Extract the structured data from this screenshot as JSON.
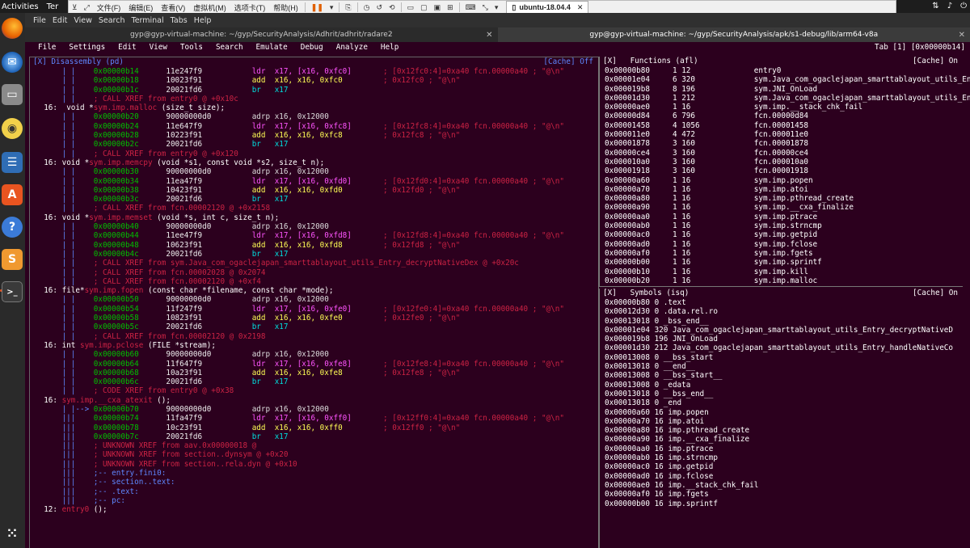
{
  "topbar": {
    "activities": "Activities",
    "app_label": "Ter"
  },
  "vmware": {
    "menus": [
      "文件(F)",
      "编辑(E)",
      "查看(V)",
      "虚拟机(M)",
      "选项卡(T)",
      "帮助(H)"
    ],
    "tab_label": "ubuntu-18.04.4"
  },
  "terminal": {
    "menubar": [
      "File",
      "Edit",
      "View",
      "Search",
      "Terminal",
      "Tabs",
      "Help"
    ],
    "tabs": [
      {
        "title": "gyp@gyp-virtual-machine: ~/gyp/SecurityAnalysis/Adhrit/adhrit/radare2",
        "active": false
      },
      {
        "title": "gyp@gyp-virtual-machine: ~/gyp/SecurityAnalysis/apk/s1-debug/lib/arm64-v8a",
        "active": true
      }
    ]
  },
  "r2": {
    "menu": [
      "File",
      "Settings",
      "Edit",
      "View",
      "Tools",
      "Search",
      "Emulate",
      "Debug",
      "Analyze",
      "Help"
    ],
    "tab_indicator": "Tab [1] [0x00000b14]",
    "disasm_title": "[X] Disassembly (pd)",
    "disasm_cache": "[Cache] Off",
    "functions_title": "[X]   Functions (afl)",
    "functions_cache": "[Cache] On",
    "symbols_title": "[X]   Symbols (isq)",
    "symbols_cache": "[Cache] On"
  },
  "disasm": [
    {
      "g": "      | |    ",
      "a": "0x00000b14",
      "b": "11e247f9",
      "m": "ldr",
      "o": "x17, [x16, 0xfc0]",
      "c": "; [0x12fc0:4]=0xa40 fcn.00000a40 ; \"@\\n\"",
      "k": "ldr"
    },
    {
      "g": "      | |    ",
      "a": "0x00000b18",
      "b": "10023f91",
      "m": "add",
      "o": "x16, x16, 0xfc0",
      "c": "; 0x12fc0 ; \"@\\n\"",
      "k": "add"
    },
    {
      "g": "      | |    ",
      "a": "0x00000b1c",
      "b": "20021fd6",
      "m": "br",
      "o": "x17",
      "c": "",
      "k": "br"
    },
    {
      "t": "x",
      "g": "      | |    ",
      "text": "; CALL XREF from entry0 @ +0x10c"
    },
    {
      "t": "s",
      "g": "  ",
      "text": "16:  void *",
      "sym": "sym.imp.malloc",
      "rest": " (size_t size);"
    },
    {
      "g": "      | |    ",
      "a": "0x00000b20",
      "b": "90000000",
      "bc": "d0",
      "m": "adrp",
      "o": "x16, 0x12000",
      "c": "",
      "k": "adrp"
    },
    {
      "g": "      | |    ",
      "a": "0x00000b24",
      "b": "11e647f9",
      "m": "ldr",
      "o": "x17, [x16, 0xfc8]",
      "c": "; [0x12fc8:4]=0xa40 fcn.00000a40 ; \"@\\n\"",
      "k": "ldr"
    },
    {
      "g": "      | |    ",
      "a": "0x00000b28",
      "b": "10223f91",
      "m": "add",
      "o": "x16, x16, 0xfc8",
      "c": "; 0x12fc8 ; \"@\\n\"",
      "k": "add"
    },
    {
      "g": "      | |    ",
      "a": "0x00000b2c",
      "b": "20021fd6",
      "m": "br",
      "o": "x17",
      "c": "",
      "k": "br"
    },
    {
      "t": "x",
      "g": "      | |    ",
      "text": "; CALL XREF from entry0 @ +0x120"
    },
    {
      "t": "s",
      "g": "  ",
      "text": "16: void *",
      "sym": "sym.imp.memcpy",
      "rest": " (void *s1, const void *s2, size_t n);"
    },
    {
      "g": "      | |    ",
      "a": "0x00000b30",
      "b": "90000000",
      "bc": "d0",
      "m": "adrp",
      "o": "x16, 0x12000",
      "c": "",
      "k": "adrp"
    },
    {
      "g": "      | |    ",
      "a": "0x00000b34",
      "b": "11ea47f9",
      "m": "ldr",
      "o": "x17, [x16, 0xfd0]",
      "c": "; [0x12fd0:4]=0xa40 fcn.00000a40 ; \"@\\n\"",
      "k": "ldr"
    },
    {
      "g": "      | |    ",
      "a": "0x00000b38",
      "b": "10423f91",
      "m": "add",
      "o": "x16, x16, 0xfd0",
      "c": "; 0x12fd0 ; \"@\\n\"",
      "k": "add"
    },
    {
      "g": "      | |    ",
      "a": "0x00000b3c",
      "b": "20021fd6",
      "m": "br",
      "o": "x17",
      "c": "",
      "k": "br"
    },
    {
      "t": "x",
      "g": "      | |    ",
      "text": "; CALL XREF from fcn.00002120 @ +0x2158"
    },
    {
      "t": "s",
      "g": "  ",
      "text": "16: void *",
      "sym": "sym.imp.memset",
      "rest": " (void *s, int c, size_t n);"
    },
    {
      "g": "      | |    ",
      "a": "0x00000b40",
      "b": "90000000",
      "bc": "d0",
      "m": "adrp",
      "o": "x16, 0x12000",
      "c": "",
      "k": "adrp"
    },
    {
      "g": "      | |    ",
      "a": "0x00000b44",
      "b": "11ee47f9",
      "m": "ldr",
      "o": "x17, [x16, 0xfd8]",
      "c": "; [0x12fd8:4]=0xa40 fcn.00000a40 ; \"@\\n\"",
      "k": "ldr"
    },
    {
      "g": "      | |    ",
      "a": "0x00000b48",
      "b": "10623f91",
      "m": "add",
      "o": "x16, x16, 0xfd8",
      "c": "; 0x12fd8 ; \"@\\n\"",
      "k": "add"
    },
    {
      "g": "      | |    ",
      "a": "0x00000b4c",
      "b": "20021fd6",
      "m": "br",
      "o": "x17",
      "c": "",
      "k": "br"
    },
    {
      "t": "x",
      "g": "      | |    ",
      "text": "; CALL XREF from sym.Java_com_ogaclejapan_smarttablayout_utils_Entry_decryptNativeDex @ +0x20c"
    },
    {
      "t": "x",
      "g": "      | |    ",
      "text": "; CALL XREF from fcn.00002028 @ 0x2074"
    },
    {
      "t": "x",
      "g": "      | |    ",
      "text": "; CALL XREF from fcn.00002120 @ +0xf4"
    },
    {
      "t": "s",
      "g": "  ",
      "text": "16: file*",
      "sym": "sym.imp.fopen",
      "rest": " (const char *filename, const char *mode);"
    },
    {
      "g": "      | |    ",
      "a": "0x00000b50",
      "b": "90000000",
      "bc": "d0",
      "m": "adrp",
      "o": "x16, 0x12000",
      "c": "",
      "k": "adrp"
    },
    {
      "g": "      | |    ",
      "a": "0x00000b54",
      "b": "11f247f9",
      "m": "ldr",
      "o": "x17, [x16, 0xfe0]",
      "c": "; [0x12fe0:4]=0xa40 fcn.00000a40 ; \"@\\n\"",
      "k": "ldr"
    },
    {
      "g": "      | |    ",
      "a": "0x00000b58",
      "b": "10823f91",
      "m": "add",
      "o": "x16, x16, 0xfe0",
      "c": "; 0x12fe0 ; \"@\\n\"",
      "k": "add"
    },
    {
      "g": "      | |    ",
      "a": "0x00000b5c",
      "b": "20021fd6",
      "m": "br",
      "o": "x17",
      "c": "",
      "k": "br"
    },
    {
      "t": "x",
      "g": "      | |    ",
      "text": "; CALL XREF from fcn.00002120 @ 0x2198"
    },
    {
      "t": "s",
      "g": "  ",
      "text": "16: int ",
      "sym": "sym.imp.pclose",
      "rest": " (FILE *stream);"
    },
    {
      "g": "      | |    ",
      "a": "0x00000b60",
      "b": "90000000",
      "bc": "d0",
      "m": "adrp",
      "o": "x16, 0x12000",
      "c": "",
      "k": "adrp"
    },
    {
      "g": "      | |    ",
      "a": "0x00000b64",
      "b": "11f647f9",
      "m": "ldr",
      "o": "x17, [x16, 0xfe8]",
      "c": "; [0x12fe8:4]=0xa40 fcn.00000a40 ; \"@\\n\"",
      "k": "ldr"
    },
    {
      "g": "      | |    ",
      "a": "0x00000b68",
      "b": "10a23f91",
      "m": "add",
      "o": "x16, x16, 0xfe8",
      "c": "; 0x12fe8 ; \"@\\n\"",
      "k": "add"
    },
    {
      "g": "      | |    ",
      "a": "0x00000b6c",
      "b": "20021fd6",
      "m": "br",
      "o": "x17",
      "c": "",
      "k": "br"
    },
    {
      "t": "x",
      "g": "      | |    ",
      "text": "; CODE XREF from entry0 @ +0x38"
    },
    {
      "t": "s",
      "g": "  ",
      "text": "16: ",
      "sym": "sym.imp.__cxa_atexit",
      "rest": " ();"
    },
    {
      "g": "      | |--> ",
      "a": "0x00000b70",
      "b": "90000000",
      "bc": "d0",
      "m": "adrp",
      "o": "x16, 0x12000",
      "c": "",
      "k": "adrp"
    },
    {
      "g": "      |||    ",
      "a": "0x00000b74",
      "b": "11fa47f9",
      "m": "ldr",
      "o": "x17, [x16, 0xff0]",
      "c": "; [0x12ff0:4]=0xa40 fcn.00000a40 ; \"@\\n\"",
      "k": "ldr"
    },
    {
      "g": "      |||    ",
      "a": "0x00000b78",
      "b": "10c23f91",
      "m": "add",
      "o": "x16, x16, 0xff0",
      "c": "; 0x12ff0 ; \"@\\n\"",
      "k": "add"
    },
    {
      "g": "      |||    ",
      "a": "0x00000b7c",
      "b": "20021fd6",
      "m": "br",
      "o": "x17",
      "c": "",
      "k": "br"
    },
    {
      "t": "x",
      "g": "      |||    ",
      "text": "; UNKNOWN XREF from aav.0x00000018 @"
    },
    {
      "t": "x",
      "g": "      |||    ",
      "text": "; UNKNOWN XREF from section..dynsym @ +0x20"
    },
    {
      "t": "x",
      "g": "      |||    ",
      "text": "; UNKNOWN XREF from section..rela.dyn @ +0x10"
    },
    {
      "t": "b",
      "g": "      |||    ",
      "text": ";-- entry.fini0:"
    },
    {
      "t": "b",
      "g": "      |||    ",
      "text": ";-- section..text:"
    },
    {
      "t": "b",
      "g": "      |||    ",
      "text": ";-- .text:"
    },
    {
      "t": "b",
      "g": "      |||    ",
      "text": ";-- pc:"
    },
    {
      "t": "e",
      "g": "  ",
      "text": "12: ",
      "sym": "entry0",
      "rest": " ();"
    }
  ],
  "functions": [
    [
      "0x00000b80",
      "1",
      "12",
      "entry0"
    ],
    [
      "0x00001e04",
      "6",
      "320",
      "sym.Java_com_ogaclejapan_smarttablayout_utils_En"
    ],
    [
      "0x000019b8",
      "8",
      "196",
      "sym.JNI_OnLoad"
    ],
    [
      "0x00001d30",
      "1",
      "212",
      "sym.Java_com_ogaclejapan_smarttablayout_utils_En"
    ],
    [
      "0x00000ae0",
      "1",
      "16",
      "sym.imp.__stack_chk_fail"
    ],
    [
      "0x00000d84",
      "6",
      "796",
      "fcn.00000d84"
    ],
    [
      "0x00001458",
      "4",
      "1056",
      "fcn.00001458"
    ],
    [
      "0x000011e0",
      "4",
      "472",
      "fcn.000011e0"
    ],
    [
      "0x00001878",
      "3",
      "160",
      "fcn.00001878"
    ],
    [
      "0x00000ce4",
      "3",
      "160",
      "fcn.00000ce4"
    ],
    [
      "0x000010a0",
      "3",
      "160",
      "fcn.000010a0"
    ],
    [
      "0x00001918",
      "3",
      "160",
      "fcn.00001918"
    ],
    [
      "0x00000a60",
      "1",
      "16",
      "sym.imp.popen"
    ],
    [
      "0x00000a70",
      "1",
      "16",
      "sym.imp.atoi"
    ],
    [
      "0x00000a80",
      "1",
      "16",
      "sym.imp.pthread_create"
    ],
    [
      "0x00000a90",
      "1",
      "16",
      "sym.imp.__cxa_finalize"
    ],
    [
      "0x00000aa0",
      "1",
      "16",
      "sym.imp.ptrace"
    ],
    [
      "0x00000ab0",
      "1",
      "16",
      "sym.imp.strncmp"
    ],
    [
      "0x00000ac0",
      "1",
      "16",
      "sym.imp.getpid"
    ],
    [
      "0x00000ad0",
      "1",
      "16",
      "sym.imp.fclose"
    ],
    [
      "0x00000af0",
      "1",
      "16",
      "sym.imp.fgets"
    ],
    [
      "0x00000b00",
      "1",
      "16",
      "sym.imp.sprintf"
    ],
    [
      "0x00000b10",
      "1",
      "16",
      "sym.imp.kill"
    ],
    [
      "0x00000b20",
      "1",
      "16",
      "sym.imp.malloc"
    ]
  ],
  "symbols": [
    "0x00000b80 0 .text",
    "0x00012d30 0 .data.rel.ro",
    "0x00013018 0 _bss_end__",
    "0x00001e04 320 Java_com_ogaclejapan_smarttablayout_utils_Entry_decryptNativeD",
    "0x000019b8 196 JNI_OnLoad",
    "0x00001d30 212 Java_com_ogaclejapan_smarttablayout_utils_Entry_handleNativeCo",
    "0x00013008 0 __bss_start",
    "0x00013018 0 __end__",
    "0x00013008 0 __bss_start__",
    "0x00013008 0 _edata",
    "0x00013018 0 __bss_end__",
    "0x00013018 0 _end",
    "0x00000a60 16 imp.popen",
    "0x00000a70 16 imp.atoi",
    "0x00000a80 16 imp.pthread_create",
    "0x00000a90 16 imp.__cxa_finalize",
    "0x00000aa0 16 imp.ptrace",
    "0x00000ab0 16 imp.strncmp",
    "0x00000ac0 16 imp.getpid",
    "0x00000ad0 16 imp.fclose",
    "0x00000ae0 16 imp.__stack_chk_fail",
    "0x00000af0 16 imp.fgets",
    "0x00000b00 16 imp.sprintf"
  ],
  "colors": {
    "terminal_bg": "#2c001e",
    "address": "#00c000",
    "comment": "#cc2244",
    "ldr": "#ff55ff",
    "add": "#ffff55",
    "br": "#00e0e0",
    "panel_title": "#5f87ff",
    "ubuntu_orange": "#e95420"
  },
  "dock_icons": [
    "firefox-icon",
    "thunderbird-icon",
    "files-icon",
    "rhythmbox-icon",
    "writer-icon",
    "software-icon",
    "help-icon",
    "sublime-icon",
    "terminal-icon",
    "apps-grid-icon"
  ]
}
